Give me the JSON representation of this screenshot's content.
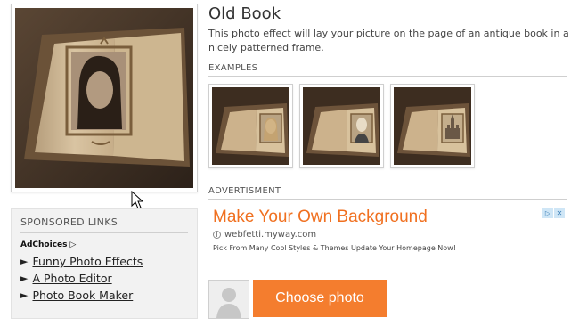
{
  "effect": {
    "title": "Old Book",
    "description": "This photo effect will lay your picture on the page of an antique book in a nicely patterned frame."
  },
  "examples": {
    "label": "EXAMPLES"
  },
  "advert": {
    "label": "ADVERTISMENT",
    "headline": "Make Your Own Background",
    "url": "webfetti.myway.com",
    "text": "Pick From Many Cool Styles & Themes Update Your Homepage Now!",
    "badge": [
      "▷",
      "✕"
    ]
  },
  "sponsored": {
    "title": "SPONSORED LINKS",
    "adchoices": "AdChoices",
    "links": [
      {
        "arrow": "►",
        "label": "Funny Photo Effects"
      },
      {
        "arrow": "►",
        "label": "A Photo Editor"
      },
      {
        "arrow": "►",
        "label": "Photo Book Maker"
      }
    ]
  },
  "actions": {
    "choose_photo": "Choose photo"
  },
  "colors": {
    "accent": "#f47d2e",
    "ad_headline": "#f07020"
  }
}
